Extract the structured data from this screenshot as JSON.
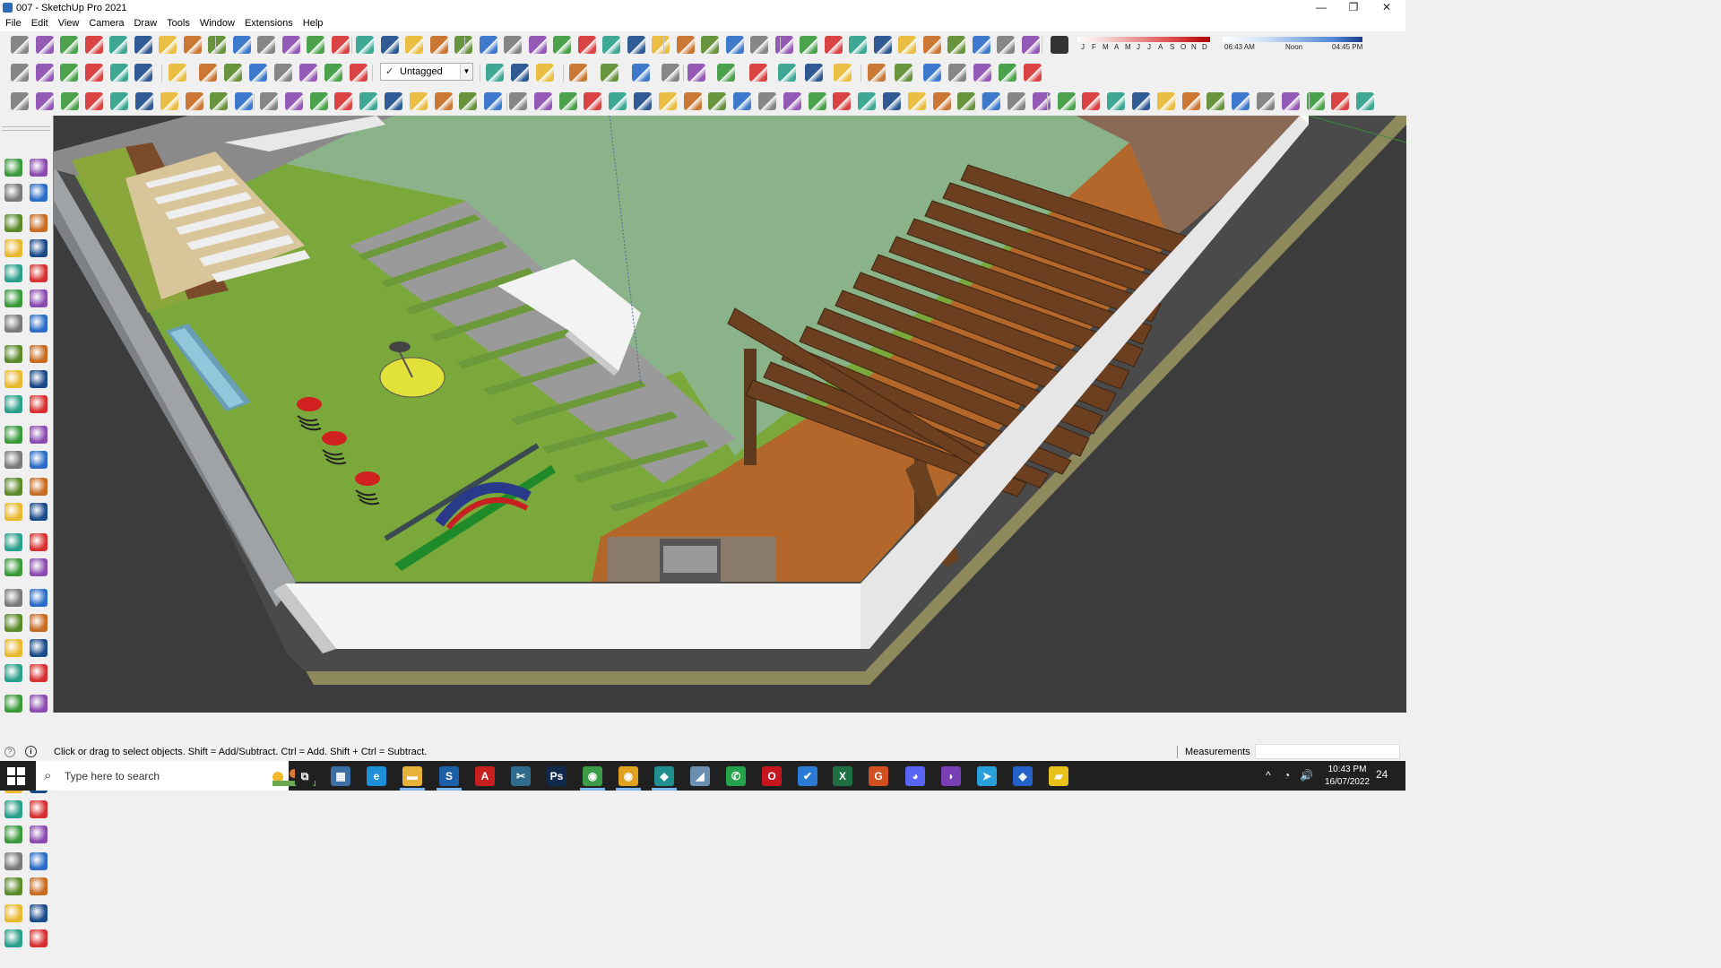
{
  "window": {
    "title": "007 - SketchUp Pro 2021",
    "minimize_glyph": "—",
    "maximize_glyph": "❐",
    "close_glyph": "✕"
  },
  "menu": [
    "File",
    "Edit",
    "View",
    "Camera",
    "Draw",
    "Tools",
    "Window",
    "Extensions",
    "Help"
  ],
  "tag_select": {
    "check": "✓",
    "value": "Untagged"
  },
  "shadow_settings": {
    "months": [
      "J",
      "F",
      "M",
      "A",
      "M",
      "J",
      "J",
      "A",
      "S",
      "O",
      "N",
      "D"
    ],
    "time_start": "06:43 AM",
    "time_mid": "Noon",
    "time_end": "04:45 PM"
  },
  "statusbar": {
    "info_glyph": "?",
    "tip_glyph": "i",
    "message": "Click or drag to select objects. Shift = Add/Subtract. Ctrl = Add. Shift + Ctrl = Subtract.",
    "measurements_label": "Measurements"
  },
  "taskbar": {
    "search_placeholder": "Type here to search",
    "search_icon": "⌕",
    "apps": [
      {
        "name": "task-view",
        "glyph": "⧉",
        "color": "#202020"
      },
      {
        "name": "calculator",
        "glyph": "▦",
        "color": "#3a6ea5"
      },
      {
        "name": "edge",
        "glyph": "e",
        "color": "#1f8fd8"
      },
      {
        "name": "file-explorer",
        "glyph": "▬",
        "color": "#e8b23a"
      },
      {
        "name": "sketchup",
        "glyph": "S",
        "color": "#1b5fa8"
      },
      {
        "name": "acrobat",
        "glyph": "A",
        "color": "#c8201f"
      },
      {
        "name": "snipping",
        "glyph": "✂",
        "color": "#2f6b8c"
      },
      {
        "name": "photoshop",
        "glyph": "Ps",
        "color": "#0f2a4a"
      },
      {
        "name": "chrome-1",
        "glyph": "◉",
        "color": "#3c9b47"
      },
      {
        "name": "chrome-2",
        "glyph": "◉",
        "color": "#e0a020"
      },
      {
        "name": "app-teal",
        "glyph": "◆",
        "color": "#1f8f8f"
      },
      {
        "name": "app-paper",
        "glyph": "◢",
        "color": "#6a8fb0"
      },
      {
        "name": "whatsapp",
        "glyph": "✆",
        "color": "#25a34a"
      },
      {
        "name": "opera",
        "glyph": "O",
        "color": "#c4161c"
      },
      {
        "name": "todo",
        "glyph": "✔",
        "color": "#2b7bd6"
      },
      {
        "name": "excel",
        "glyph": "X",
        "color": "#1d6f42"
      },
      {
        "name": "grammarly",
        "glyph": "G",
        "color": "#d2501f"
      },
      {
        "name": "discord",
        "glyph": "◕",
        "color": "#5865f2"
      },
      {
        "name": "app-purple",
        "glyph": "◗",
        "color": "#7b3fb5"
      },
      {
        "name": "telegram",
        "glyph": "➤",
        "color": "#2aa0da"
      },
      {
        "name": "app-blue",
        "glyph": "◈",
        "color": "#2462c9"
      },
      {
        "name": "sticky-notes",
        "glyph": "▰",
        "color": "#e8c21a"
      }
    ],
    "tray_up": "^",
    "tray_wifi": "◔",
    "tray_volume": "🔊",
    "time": "10:43 PM",
    "date": "16/07/2022",
    "notifications": "24"
  }
}
